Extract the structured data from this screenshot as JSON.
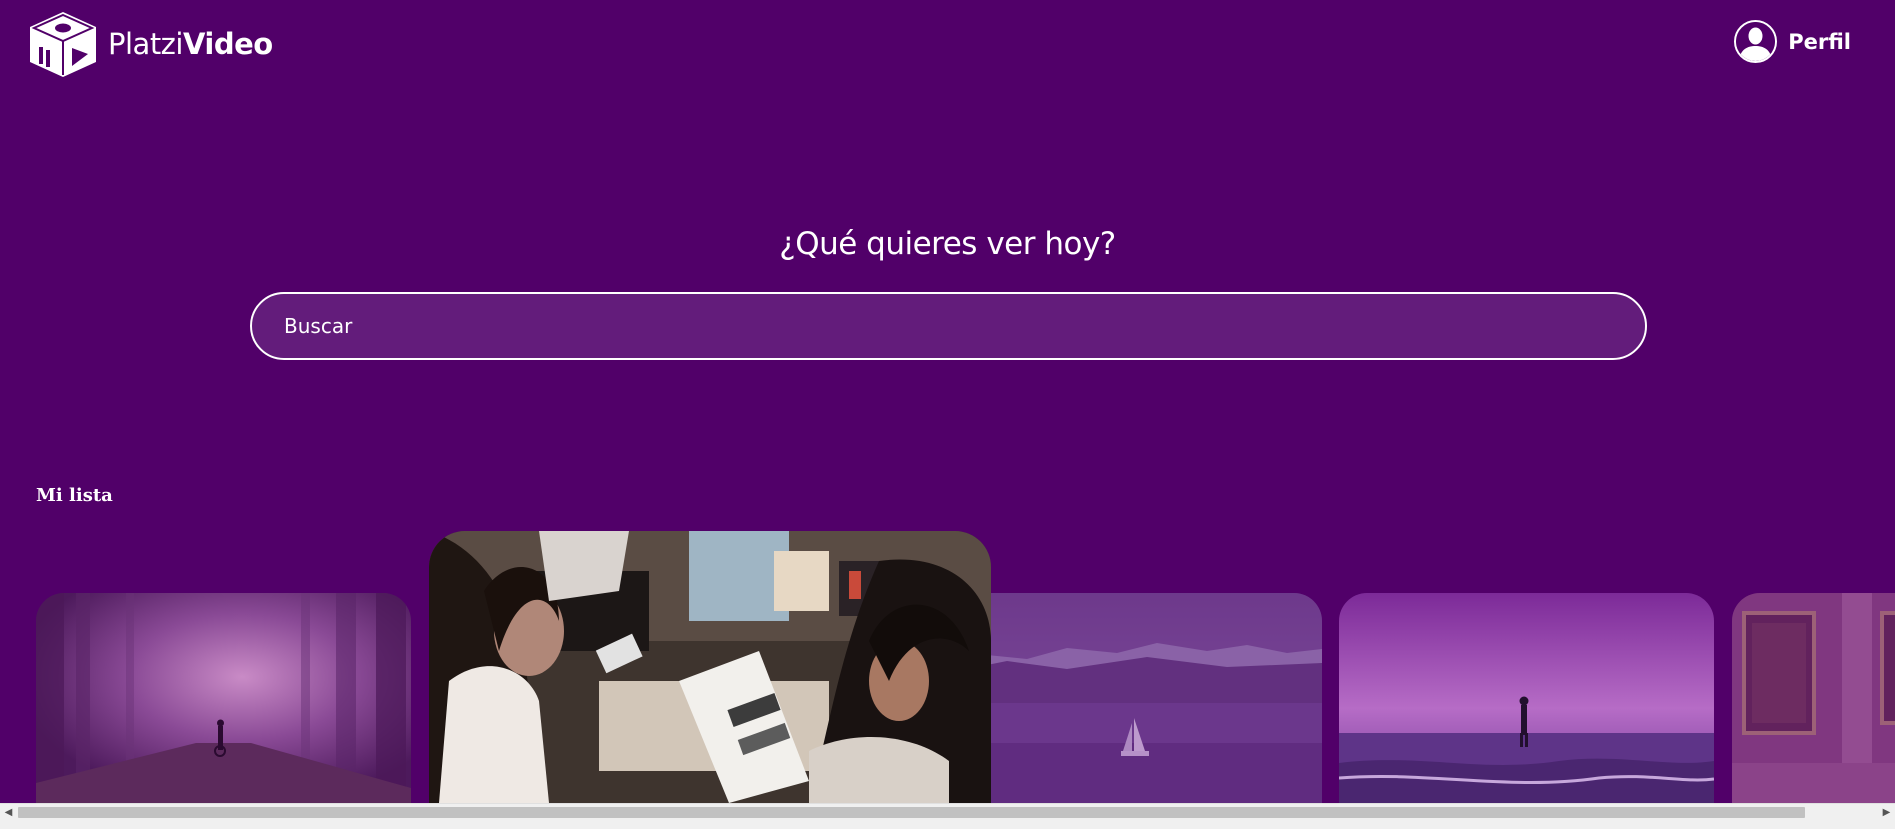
{
  "header": {
    "logo": {
      "icon": "platzi-video-cube-icon",
      "text_light": "Platzi",
      "text_bold": "Video"
    },
    "profile": {
      "icon": "user-avatar-icon",
      "label": "Perfil"
    }
  },
  "main": {
    "title": "¿Qué quieres ver hoy?",
    "search": {
      "placeholder": "Buscar",
      "value": ""
    }
  },
  "categories": [
    {
      "title": "Mi lista",
      "items": [
        {
          "image": "misty-forest-path-cyclist"
        },
        {
          "image": "friends-reading-magazine"
        },
        {
          "image": "mountain-lake-sailboat"
        },
        {
          "image": "person-on-beach-sunset"
        },
        {
          "image": "museum-gallery-paintings"
        }
      ]
    }
  ],
  "colors": {
    "background": "#510069",
    "search_fill": "#631c7b",
    "text": "#ffffff"
  }
}
